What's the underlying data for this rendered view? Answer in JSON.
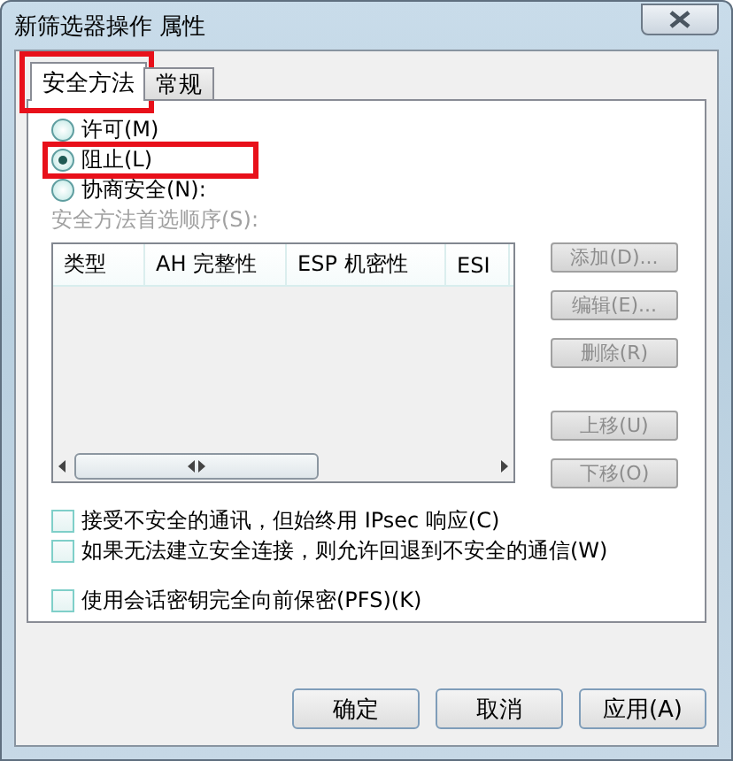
{
  "window": {
    "title": "新筛选器操作 属性"
  },
  "tabs": [
    {
      "label": "安全方法",
      "selected": true,
      "highlighted": true
    },
    {
      "label": "常规",
      "selected": false,
      "highlighted": false
    }
  ],
  "radios": [
    {
      "label": "许可(M)",
      "selected": false,
      "highlighted": false
    },
    {
      "label": "阻止(L)",
      "selected": true,
      "highlighted": true
    },
    {
      "label": "协商安全(N):",
      "selected": false,
      "highlighted": false
    }
  ],
  "order_label": {
    "text": "安全方法首选顺序(S):",
    "disabled": true
  },
  "table": {
    "columns": [
      "类型",
      "AH 完整性",
      "ESP 机密性",
      "ESI"
    ]
  },
  "side_buttons": [
    {
      "label": "添加(D)...",
      "disabled": true
    },
    {
      "label": "编辑(E)...",
      "disabled": true
    },
    {
      "label": "删除(R)",
      "disabled": true
    },
    {
      "label": "上移(U)",
      "disabled": true
    },
    {
      "label": "下移(O)",
      "disabled": true
    }
  ],
  "checkboxes": [
    {
      "label": "接受不安全的通讯，但始终用 IPsec 响应(C)",
      "checked": false
    },
    {
      "label": "如果无法建立安全连接，则允许回退到不安全的通信(W)",
      "checked": false
    },
    {
      "label": "使用会话密钥完全向前保密(PFS)(K)",
      "checked": false
    }
  ],
  "buttons": [
    {
      "label": "确定"
    },
    {
      "label": "取消"
    },
    {
      "label": "应用(A)"
    }
  ]
}
